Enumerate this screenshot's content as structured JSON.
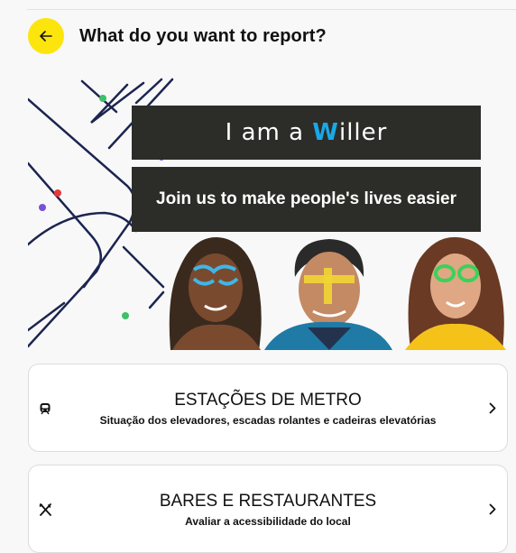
{
  "header": {
    "title": "What do you want to report?",
    "back_icon": "arrow-left-icon",
    "accent": "#fce40d"
  },
  "banner": {
    "headline_prefix": "I am a ",
    "headline_accent": "W",
    "headline_suffix": "iller",
    "subline": "Join us to make people's lives easier"
  },
  "cards": [
    {
      "icon": "metro-train-icon",
      "title": "ESTAÇÕES DE METRO",
      "subtitle": "Situação dos elevadores, escadas rolantes e cadeiras elevatórias"
    },
    {
      "icon": "fork-knife-icon",
      "title": "BARES E RESTAURANTES",
      "subtitle": "Avaliar a acessibilidade do local"
    }
  ]
}
